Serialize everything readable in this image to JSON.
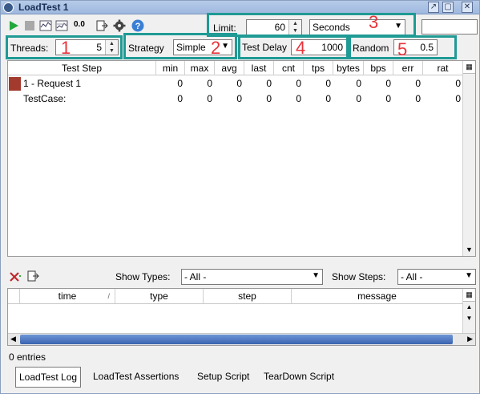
{
  "window": {
    "title": "LoadTest 1"
  },
  "toolbar": {
    "icons": [
      "run-icon",
      "stop-icon",
      "graph-icon",
      "statistics-icon",
      "zero-icon",
      "export-icon",
      "settings-icon",
      "help-icon"
    ],
    "zero_label": "0.0",
    "limit_label": "Limit:",
    "limit_value": "60",
    "limit_unit": "Seconds",
    "threads_label": "Threads:",
    "threads_value": "5",
    "strategy_label": "Strategy",
    "strategy_value": "Simple",
    "test_delay_label": "Test Delay",
    "test_delay_value": "1000",
    "random_label": "Random",
    "random_value": "0.5",
    "progress_value": ""
  },
  "callouts": [
    "1",
    "2",
    "3",
    "4",
    "5"
  ],
  "grid": {
    "columns": [
      "Test Step",
      "min",
      "max",
      "avg",
      "last",
      "cnt",
      "tps",
      "bytes",
      "bps",
      "err",
      "rat"
    ],
    "rows": [
      {
        "name": "1 - Request 1",
        "values": [
          "0",
          "0",
          "0",
          "0",
          "0",
          "0",
          "0",
          "0",
          "0",
          "0"
        ]
      },
      {
        "name": "TestCase:",
        "values": [
          "0",
          "0",
          "0",
          "0",
          "0",
          "0",
          "0",
          "0",
          "0",
          "0"
        ]
      }
    ]
  },
  "log_controls": {
    "show_types_label": "Show Types:",
    "show_types_value": "- All -",
    "show_steps_label": "Show Steps:",
    "show_steps_value": "- All -"
  },
  "log_table": {
    "columns": [
      "time",
      "type",
      "step",
      "message"
    ],
    "sort_indicator": "/"
  },
  "status": {
    "entries": "0 entries"
  },
  "tabs": [
    "LoadTest Log",
    "LoadTest Assertions",
    "Setup Script",
    "TearDown Script"
  ]
}
